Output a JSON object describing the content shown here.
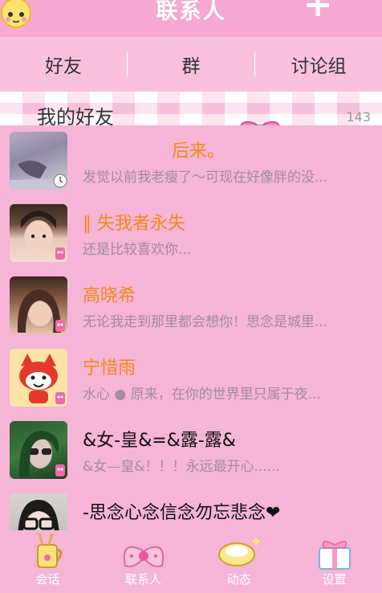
{
  "header": {
    "title": "联系人",
    "add_label": "+"
  },
  "tabs": [
    {
      "label": "好友"
    },
    {
      "label": "群"
    },
    {
      "label": "讨论组"
    }
  ],
  "group": {
    "name": "我的好友",
    "count": "143"
  },
  "contacts": [
    {
      "name": "后来。",
      "message": "发觉以前我老瘦了～可现在好像胖的没..."
    },
    {
      "name": "‖ 失我者永失",
      "message": "还是比较喜欢你..."
    },
    {
      "name": "高晓希",
      "message": "无论我走到那里都会想你！思念是城里..."
    },
    {
      "name": "宁惜雨",
      "message": "水心 ● 原来，在你的世界里只属于夜..."
    },
    {
      "name": "&女-皇&=&露-露&",
      "message": "&女—皇&！！！永远最开心......"
    },
    {
      "name": "-思念心念信念勿忘悲念❤",
      "message": ""
    }
  ],
  "bottom_nav": [
    {
      "label": "会话"
    },
    {
      "label": "联系人"
    },
    {
      "label": "动态"
    },
    {
      "label": "设置"
    }
  ],
  "colors": {
    "background": "#f6b4d6",
    "name_orange": "#f28a1a",
    "tab_bg": "#f9c1dd"
  }
}
